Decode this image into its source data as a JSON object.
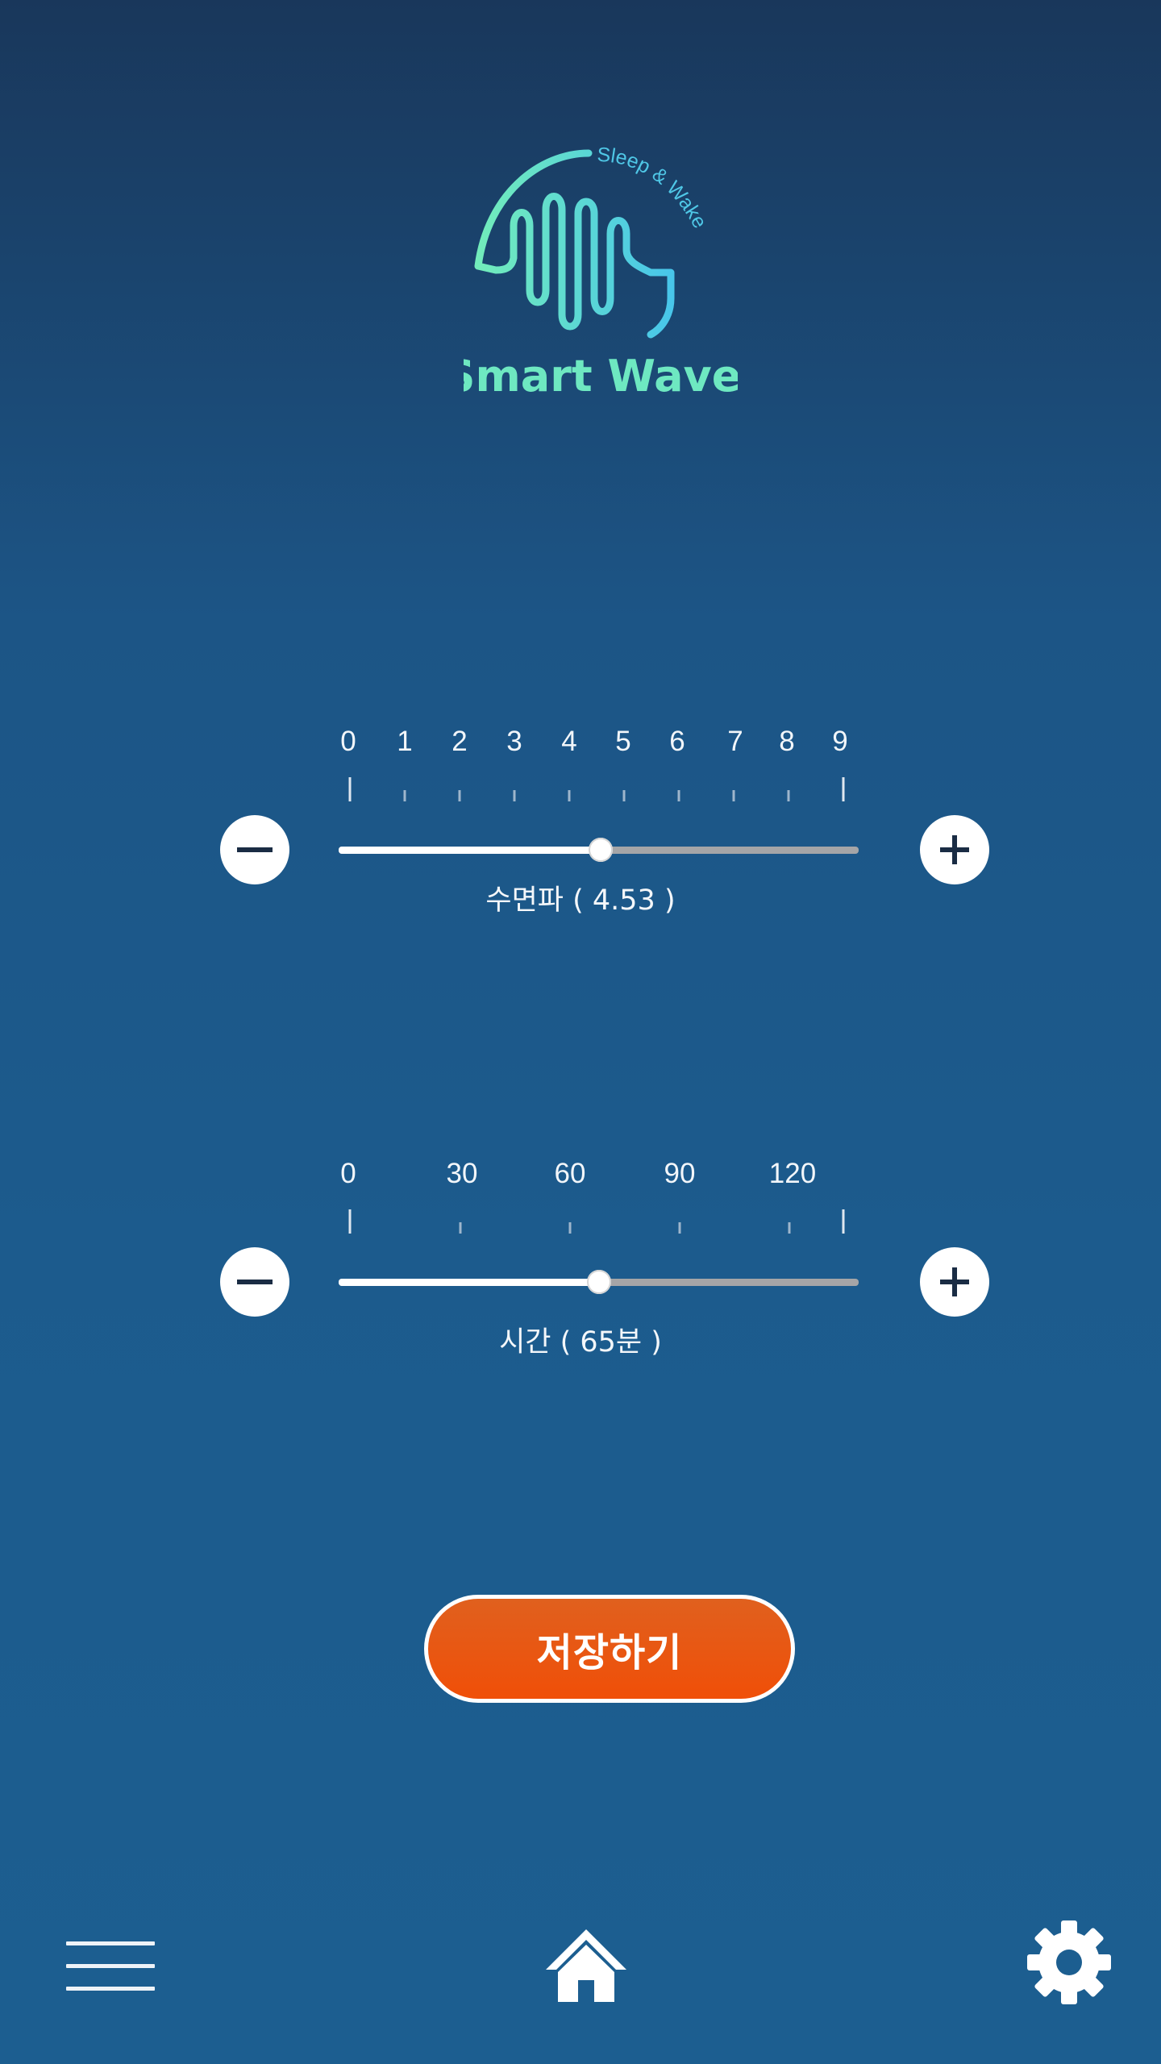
{
  "app": {
    "logo": {
      "tagline": "Sleep & Wake",
      "name": "Smart Wave",
      "colors": {
        "primary": "#6ee8c1",
        "secondary": "#4dc8e6"
      }
    }
  },
  "sleep_wave_slider": {
    "tick_labels": [
      "0",
      "1",
      "2",
      "3",
      "4",
      "5",
      "6",
      "7",
      "8",
      "9"
    ],
    "min": 0,
    "max": 9,
    "value": 4.53,
    "label": "수면파 ( 4.53 )",
    "minus_icon": "minus-icon",
    "plus_icon": "plus-icon"
  },
  "time_slider": {
    "tick_labels": [
      "0",
      "30",
      "60",
      "90",
      "120"
    ],
    "min": 0,
    "max": 130,
    "value": 65,
    "label": "시간 ( 65분 )",
    "minus_icon": "minus-icon",
    "plus_icon": "plus-icon"
  },
  "save_button": {
    "label": "저장하기",
    "color": "#f04f08"
  },
  "bottom_nav": {
    "menu_icon": "hamburger-menu-icon",
    "home_icon": "home-icon",
    "settings_icon": "gear-icon"
  },
  "colors": {
    "background_top": "#19375b",
    "background_bottom": "#1c5e90",
    "track": "#a5a5a7",
    "track_fill": "#ffffff"
  }
}
